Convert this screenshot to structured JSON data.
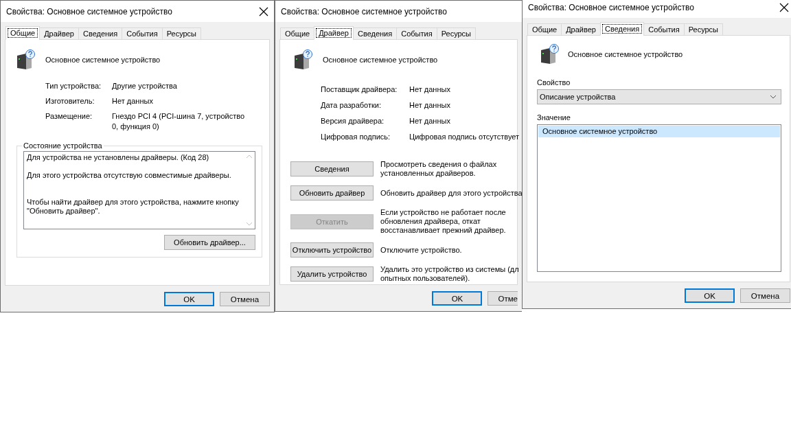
{
  "windows": [
    {
      "kind": "general",
      "title": "Свойства: Основное системное устройство",
      "close_button": true,
      "tabs": [
        {
          "label": "Общие",
          "selected": true
        },
        {
          "label": "Драйвер",
          "selected": false
        },
        {
          "label": "Сведения",
          "selected": false
        },
        {
          "label": "События",
          "selected": false
        },
        {
          "label": "Ресурсы",
          "selected": false
        }
      ],
      "device_name": "Основное системное устройство",
      "properties": [
        {
          "label": "Тип устройства:",
          "value": "Другие устройства"
        },
        {
          "label": "Изготовитель:",
          "value": "Нет данных"
        },
        {
          "label": "Размещение:",
          "value": "Гнездо PCI 4 (PCI-шина 7, устройство 0, функция 0)"
        }
      ],
      "status_group": {
        "title": "Состояние устройства",
        "text": "Для устройства не установлены драйверы. (Код 28)\n\nДля этого устройства отсутствую совместимые драйверы.\n\n\nЧтобы найти драйвер для этого устройства, нажмите кнопку \"Обновить драйвер\".",
        "button": "Обновить драйвер..."
      },
      "buttons": [
        {
          "label": "OK",
          "default": true
        },
        {
          "label": "Отмена",
          "default": false
        }
      ]
    },
    {
      "kind": "driver",
      "title": "Свойства: Основное системное устройство",
      "tabs": [
        {
          "label": "Общие",
          "selected": false
        },
        {
          "label": "Драйвер",
          "selected": true
        },
        {
          "label": "Сведения",
          "selected": false
        },
        {
          "label": "События",
          "selected": false
        },
        {
          "label": "Ресурсы",
          "selected": false
        }
      ],
      "device_name": "Основное системное устройство",
      "properties": [
        {
          "label": "Поставщик драйвера:",
          "value": "Нет данных"
        },
        {
          "label": "Дата разработки:",
          "value": "Нет данных"
        },
        {
          "label": "Версия драйвера:",
          "value": "Нет данных"
        },
        {
          "label": "Цифровая подпись:",
          "value": "Цифровая подпись отсутствует"
        }
      ],
      "actions": [
        {
          "label": "Сведения",
          "description": "Просмотреть сведения о файлах\nустановленных драйверов.",
          "disabled": false
        },
        {
          "label": "Обновить драйвер",
          "description": "Обновить драйвер для этого устройства",
          "disabled": false
        },
        {
          "label": "Откатить",
          "description": "Если устройство не работает после\nобновления драйвера, откат\nвосстанавливает прежний драйвер.",
          "disabled": true
        },
        {
          "label": "Отключить устройство",
          "description": "Отключите устройство.",
          "disabled": false
        },
        {
          "label": "Удалить устройство",
          "description": "Удалить это устройство из системы (дл\nопытных пользователей).",
          "disabled": false
        }
      ],
      "buttons": [
        {
          "label": "OK",
          "default": true
        },
        {
          "label": "Отме",
          "default": false
        }
      ]
    },
    {
      "kind": "details",
      "title": "Свойства: Основное системное устройство",
      "close_button": true,
      "tabs": [
        {
          "label": "Общие",
          "selected": false
        },
        {
          "label": "Драйвер",
          "selected": false
        },
        {
          "label": "Сведения",
          "selected": true
        },
        {
          "label": "События",
          "selected": false
        },
        {
          "label": "Ресурсы",
          "selected": false
        }
      ],
      "device_name": "Основное системное устройство",
      "property_label": "Свойство",
      "property_value": "Описание устройства",
      "value_label": "Значение",
      "values": [
        {
          "text": "Основное системное устройство",
          "selected": true
        }
      ],
      "buttons": [
        {
          "label": "OK",
          "default": true
        },
        {
          "label": "Отмена",
          "default": false
        }
      ]
    }
  ]
}
